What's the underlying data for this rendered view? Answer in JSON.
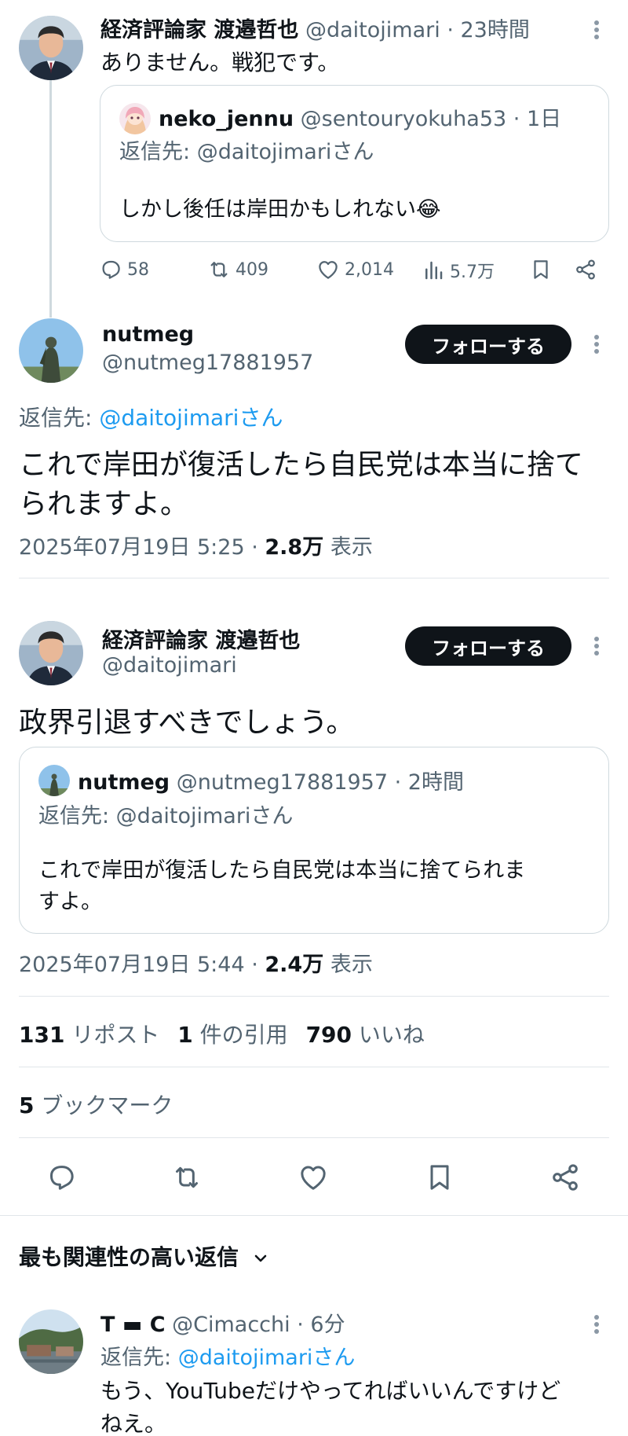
{
  "tweet1": {
    "author_name": "経済評論家 渡邉哲也",
    "author_handle": "@daitojimari",
    "time": "· 23時間",
    "text": "ありません。戦犯です。",
    "quote": {
      "author_name": "neko_jennu",
      "author_handle": "@sentouryokuha53",
      "time": "· 1日",
      "reply_prefix": "返信先: ",
      "reply_handle": "@daitojimari",
      "reply_suffix": "さん",
      "text": "しかし後任は岸田かもしれない😂"
    },
    "stats": {
      "replies": "58",
      "reposts": "409",
      "likes": "2,014",
      "views": "5.7万"
    }
  },
  "tweet2": {
    "author_name": "nutmeg",
    "author_handle": "@nutmeg17881957",
    "follow_label": "フォローする",
    "reply_prefix": "返信先: ",
    "reply_handle": "@daitojimariさん",
    "text_line1": "これで岸田が復活したら自民党は本当に捨て",
    "text_line2": "られますよ。",
    "timestamp": "2025年07月19日 5:25 · ",
    "views_count": "2.8万",
    "views_label": " 表示"
  },
  "tweet3": {
    "author_name": "経済評論家 渡邉哲也",
    "author_handle": "@daitojimari",
    "follow_label": "フォローする",
    "text": "政界引退すべきでしょう。",
    "quote": {
      "author_name": "nutmeg",
      "author_handle": "@nutmeg17881957",
      "time": "· 2時間",
      "reply_text": "返信先: @daitojimariさん",
      "text_line1": "これで岸田が復活したら自民党は本当に捨てられま",
      "text_line2": "すよ。"
    },
    "timestamp": "2025年07月19日 5:44 · ",
    "views_count": "2.4万",
    "views_label": " 表示",
    "reposts_count": "131",
    "reposts_label": " リポスト",
    "quotes_count": "1",
    "quotes_label": " 件の引用",
    "likes_count": "790",
    "likes_label": " いいね",
    "bookmarks_count": "5",
    "bookmarks_label": " ブックマーク"
  },
  "replies_header": "最も関連性の高い返信",
  "reply1": {
    "author_name": "T ▬ C",
    "author_handle": "@Cimacchi",
    "time": "· 6分",
    "reply_prefix": "返信先: ",
    "reply_handle": "@daitojimariさん",
    "text_line1": "もう、YouTubeだけやってればいいんですけど",
    "text_line2": "ねえ。"
  },
  "icons": [
    "reply-icon",
    "repost-icon",
    "like-icon",
    "views-icon",
    "bookmark-icon",
    "share-icon",
    "more-icon",
    "chevron-down-icon"
  ],
  "colors": {
    "link": "#1d9bf0",
    "secondary_text": "#536471",
    "button_bg": "#0f1419"
  }
}
